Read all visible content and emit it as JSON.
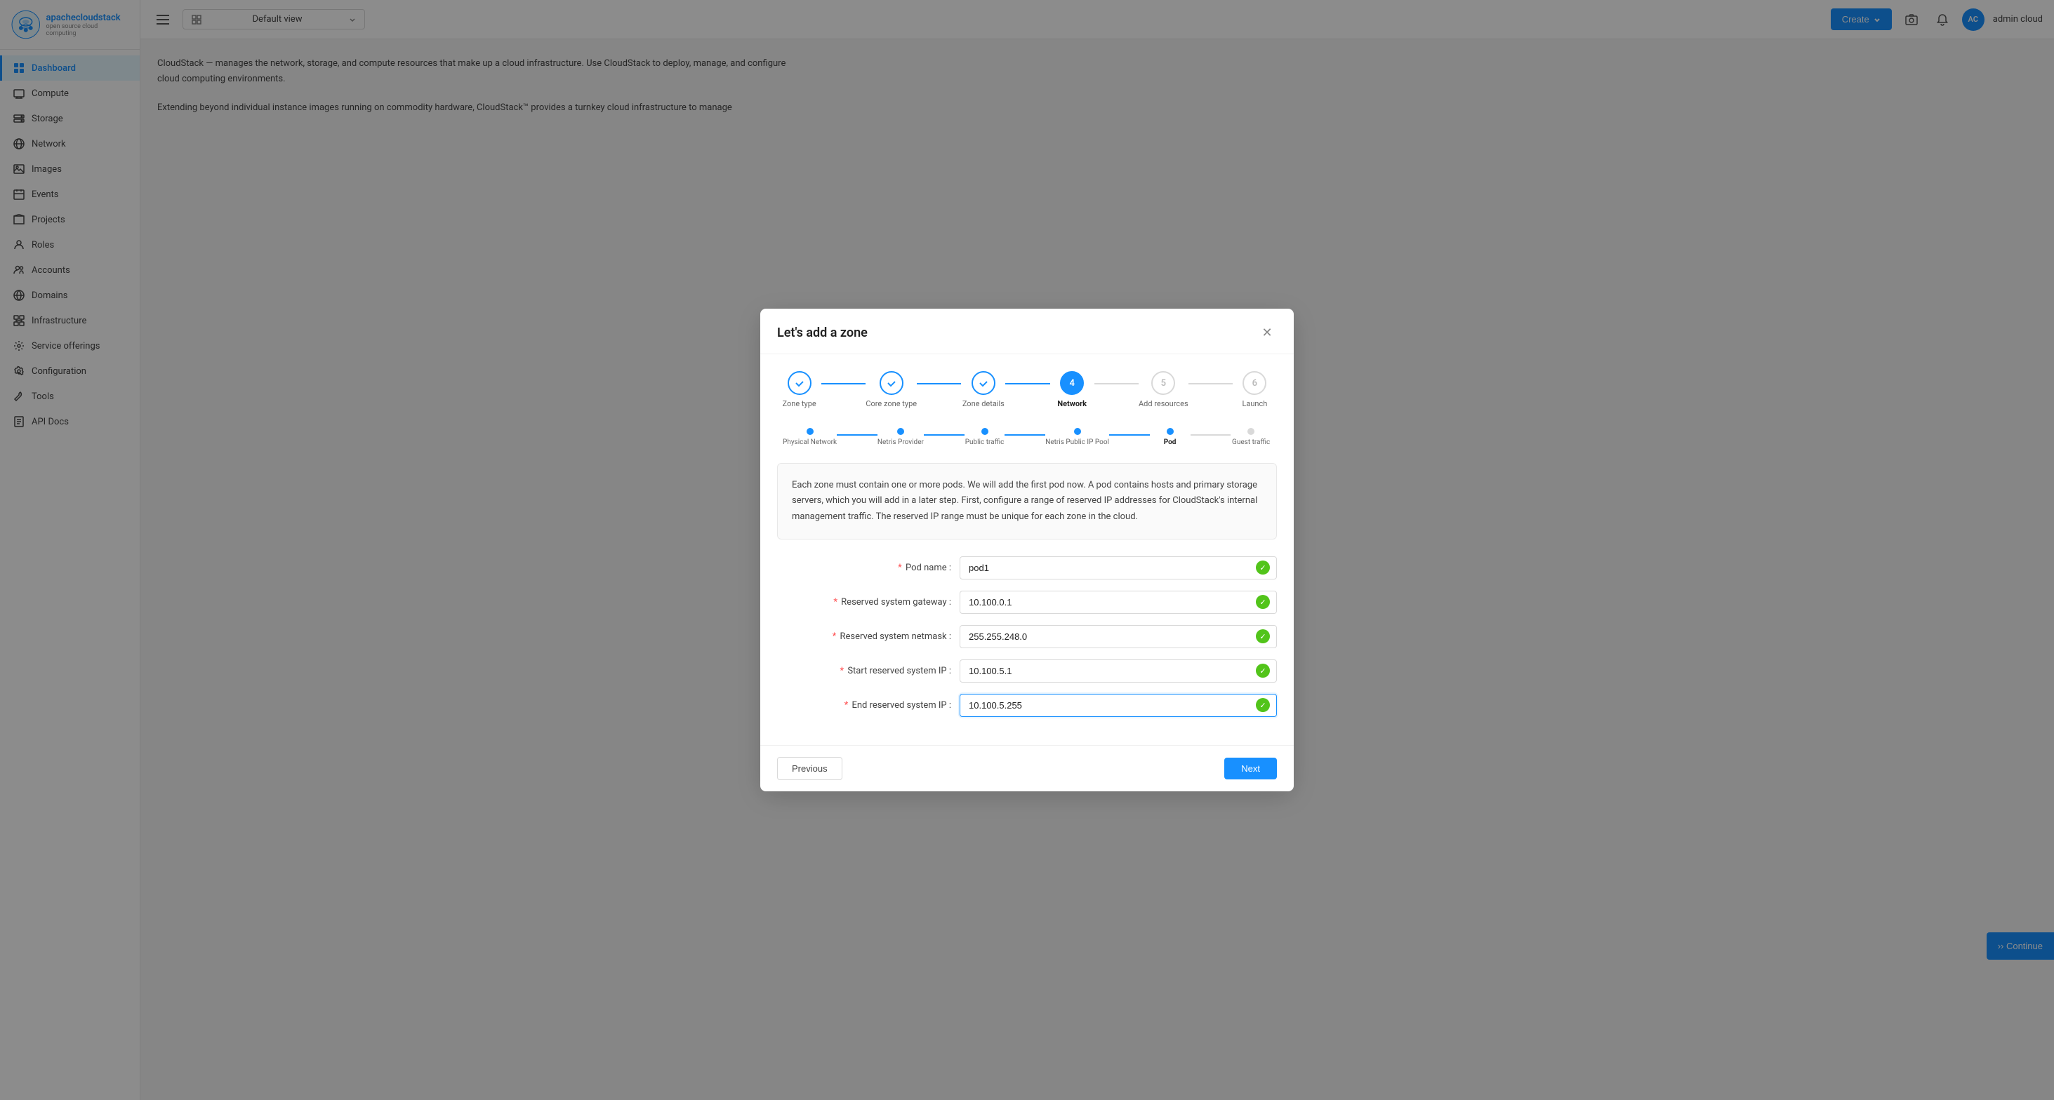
{
  "app": {
    "name": "apachecloudstack",
    "tagline": "open source cloud computing"
  },
  "topbar": {
    "view_label": "Default view",
    "create_label": "Create",
    "username": "admin cloud"
  },
  "sidebar": {
    "items": [
      {
        "id": "dashboard",
        "label": "Dashboard",
        "active": true
      },
      {
        "id": "compute",
        "label": "Compute",
        "active": false
      },
      {
        "id": "storage",
        "label": "Storage",
        "active": false
      },
      {
        "id": "network",
        "label": "Network",
        "active": false
      },
      {
        "id": "images",
        "label": "Images",
        "active": false
      },
      {
        "id": "events",
        "label": "Events",
        "active": false
      },
      {
        "id": "projects",
        "label": "Projects",
        "active": false
      },
      {
        "id": "roles",
        "label": "Roles",
        "active": false
      },
      {
        "id": "accounts",
        "label": "Accounts",
        "active": false
      },
      {
        "id": "domains",
        "label": "Domains",
        "active": false
      },
      {
        "id": "infrastructure",
        "label": "Infrastructure",
        "active": false
      },
      {
        "id": "service-offerings",
        "label": "Service offerings",
        "active": false
      },
      {
        "id": "configuration",
        "label": "Configuration",
        "active": false
      },
      {
        "id": "tools",
        "label": "Tools",
        "active": false
      },
      {
        "id": "api-docs",
        "label": "API Docs",
        "active": false
      }
    ]
  },
  "page_bg": {
    "line1": "CloudStack — manages the network, storage, and compute resources that make up a cloud infrastructure. Use CloudStack to deploy, manage, and configure cloud computing environments.",
    "line2": "Extending beyond individual instance images running on commodity hardware, CloudStack™ provides a turnkey cloud infrastructure to manage"
  },
  "modal": {
    "title": "Let's add a zone",
    "wizard_steps": [
      {
        "id": "zone-type",
        "label": "Zone type",
        "state": "completed",
        "number": "✓"
      },
      {
        "id": "core-zone-type",
        "label": "Core zone type",
        "state": "completed",
        "number": "✓"
      },
      {
        "id": "zone-details",
        "label": "Zone details",
        "state": "completed",
        "number": "✓"
      },
      {
        "id": "network",
        "label": "Network",
        "state": "active",
        "number": "4"
      },
      {
        "id": "add-resources",
        "label": "Add resources",
        "state": "inactive",
        "number": "5"
      },
      {
        "id": "launch",
        "label": "Launch",
        "state": "inactive",
        "number": "6"
      }
    ],
    "sub_steps": [
      {
        "id": "physical-network",
        "label": "Physical Network",
        "state": "completed"
      },
      {
        "id": "netris-provider",
        "label": "Netris Provider",
        "state": "completed"
      },
      {
        "id": "public-traffic",
        "label": "Public traffic",
        "state": "completed"
      },
      {
        "id": "netris-public-ip-pool",
        "label": "Netris Public IP Pool",
        "state": "completed"
      },
      {
        "id": "pod",
        "label": "Pod",
        "state": "active"
      },
      {
        "id": "guest-traffic",
        "label": "Guest traffic",
        "state": "inactive"
      }
    ],
    "info_text": "Each zone must contain one or more pods. We will add the first pod now. A pod contains hosts and primary storage servers, which you will add in a later step. First, configure a range of reserved IP addresses for CloudStack's internal management traffic. The reserved IP range must be unique for each zone in the cloud.",
    "form_fields": [
      {
        "id": "pod-name",
        "label": "Pod name",
        "value": "pod1",
        "required": true,
        "valid": true
      },
      {
        "id": "reserved-system-gateway",
        "label": "Reserved system gateway",
        "value": "10.100.0.1",
        "required": true,
        "valid": true
      },
      {
        "id": "reserved-system-netmask",
        "label": "Reserved system netmask",
        "value": "255.255.248.0",
        "required": true,
        "valid": true
      },
      {
        "id": "start-reserved-system-ip",
        "label": "Start reserved system IP",
        "value": "10.100.5.1",
        "required": true,
        "valid": true
      },
      {
        "id": "end-reserved-system-ip",
        "label": "End reserved system IP",
        "value": "10.100.5.255",
        "required": true,
        "valid": true
      }
    ],
    "footer": {
      "previous_label": "Previous",
      "next_label": "Next"
    }
  },
  "colors": {
    "brand": "#1890ff",
    "success": "#52c41a",
    "error": "#ff4d4f",
    "active_step_bg": "#1890ff",
    "completed_step_color": "#1890ff"
  }
}
